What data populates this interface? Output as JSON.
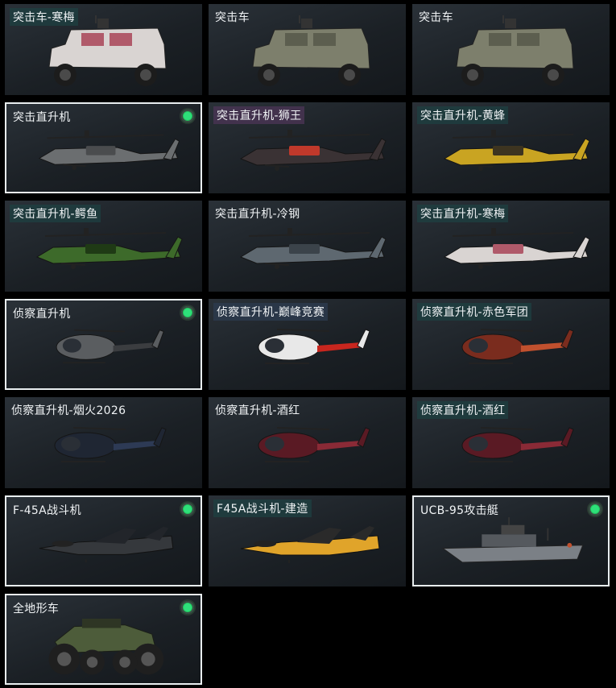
{
  "vehicles": [
    {
      "label": "突击车-寒梅",
      "kind": "truck",
      "color": "#d9d4d2",
      "accent": "#b05a6a",
      "selected": false,
      "equipped": false,
      "tag": "teal"
    },
    {
      "label": "突击车",
      "kind": "truck",
      "color": "#7d7f6c",
      "accent": "#5c5e4f",
      "selected": false,
      "equipped": false,
      "tag": "plain"
    },
    {
      "label": "突击车",
      "kind": "truck",
      "color": "#7d7f6c",
      "accent": "#5c5e4f",
      "selected": false,
      "equipped": false,
      "tag": "plain"
    },
    {
      "label": "突击直升机",
      "kind": "attack-heli",
      "color": "#6b6e70",
      "accent": "#4a4c4e",
      "selected": true,
      "equipped": true,
      "tag": "plain"
    },
    {
      "label": "突击直升机-狮王",
      "kind": "attack-heli",
      "color": "#3a3234",
      "accent": "#c0392b",
      "selected": false,
      "equipped": false,
      "tag": "violet"
    },
    {
      "label": "突击直升机-黄蜂",
      "kind": "attack-heli",
      "color": "#c9a422",
      "accent": "#3d3420",
      "selected": false,
      "equipped": false,
      "tag": "teal"
    },
    {
      "label": "突击直升机-鳄鱼",
      "kind": "attack-heli",
      "color": "#3d6a2a",
      "accent": "#1f3a15",
      "selected": false,
      "equipped": false,
      "tag": "teal"
    },
    {
      "label": "突击直升机-冷钢",
      "kind": "attack-heli",
      "color": "#5e6870",
      "accent": "#3b434a",
      "selected": false,
      "equipped": false,
      "tag": "plain"
    },
    {
      "label": "突击直升机-寒梅",
      "kind": "attack-heli",
      "color": "#d9d4d2",
      "accent": "#b05a6a",
      "selected": false,
      "equipped": false,
      "tag": "teal"
    },
    {
      "label": "侦察直升机",
      "kind": "scout-heli",
      "color": "#5a5d60",
      "accent": "#3b3d40",
      "selected": true,
      "equipped": true,
      "tag": "plain"
    },
    {
      "label": "侦察直升机-巅峰竞赛",
      "kind": "scout-heli",
      "color": "#e8e8e8",
      "accent": "#c8261e",
      "selected": false,
      "equipped": false,
      "tag": "slate"
    },
    {
      "label": "侦察直升机-赤色军团",
      "kind": "scout-heli",
      "color": "#7a2c1e",
      "accent": "#c0502e",
      "selected": false,
      "equipped": false,
      "tag": "teal"
    },
    {
      "label": "侦察直升机-烟火2026",
      "kind": "scout-heli",
      "color": "#1f2633",
      "accent": "#2d3a55",
      "selected": false,
      "equipped": false,
      "tag": "plain"
    },
    {
      "label": "侦察直升机-酒红",
      "kind": "scout-heli",
      "color": "#5a1a24",
      "accent": "#8a2a36",
      "selected": false,
      "equipped": false,
      "tag": "plain"
    },
    {
      "label": "侦察直升机-酒红",
      "kind": "scout-heli",
      "color": "#5a1a24",
      "accent": "#8a2a36",
      "selected": false,
      "equipped": false,
      "tag": "teal"
    },
    {
      "label": "F-45A战斗机",
      "kind": "jet",
      "color": "#35383c",
      "accent": "#22252a",
      "selected": true,
      "equipped": true,
      "tag": "plain"
    },
    {
      "label": "F45A战斗机-建造",
      "kind": "jet",
      "color": "#e0a42a",
      "accent": "#2a2a2a",
      "selected": false,
      "equipped": false,
      "tag": "teal"
    },
    {
      "label": "UCB-95攻击艇",
      "kind": "boat",
      "color": "#7b8086",
      "accent": "#55595e",
      "selected": true,
      "equipped": true,
      "tag": "plain"
    },
    {
      "label": "全地形车",
      "kind": "atv",
      "color": "#4d5c3a",
      "accent": "#2e3524",
      "selected": true,
      "equipped": true,
      "tag": "plain"
    }
  ],
  "colors": {
    "equipped": "#22c55e",
    "selected_border": "#e9eef0",
    "background": "#000000"
  }
}
